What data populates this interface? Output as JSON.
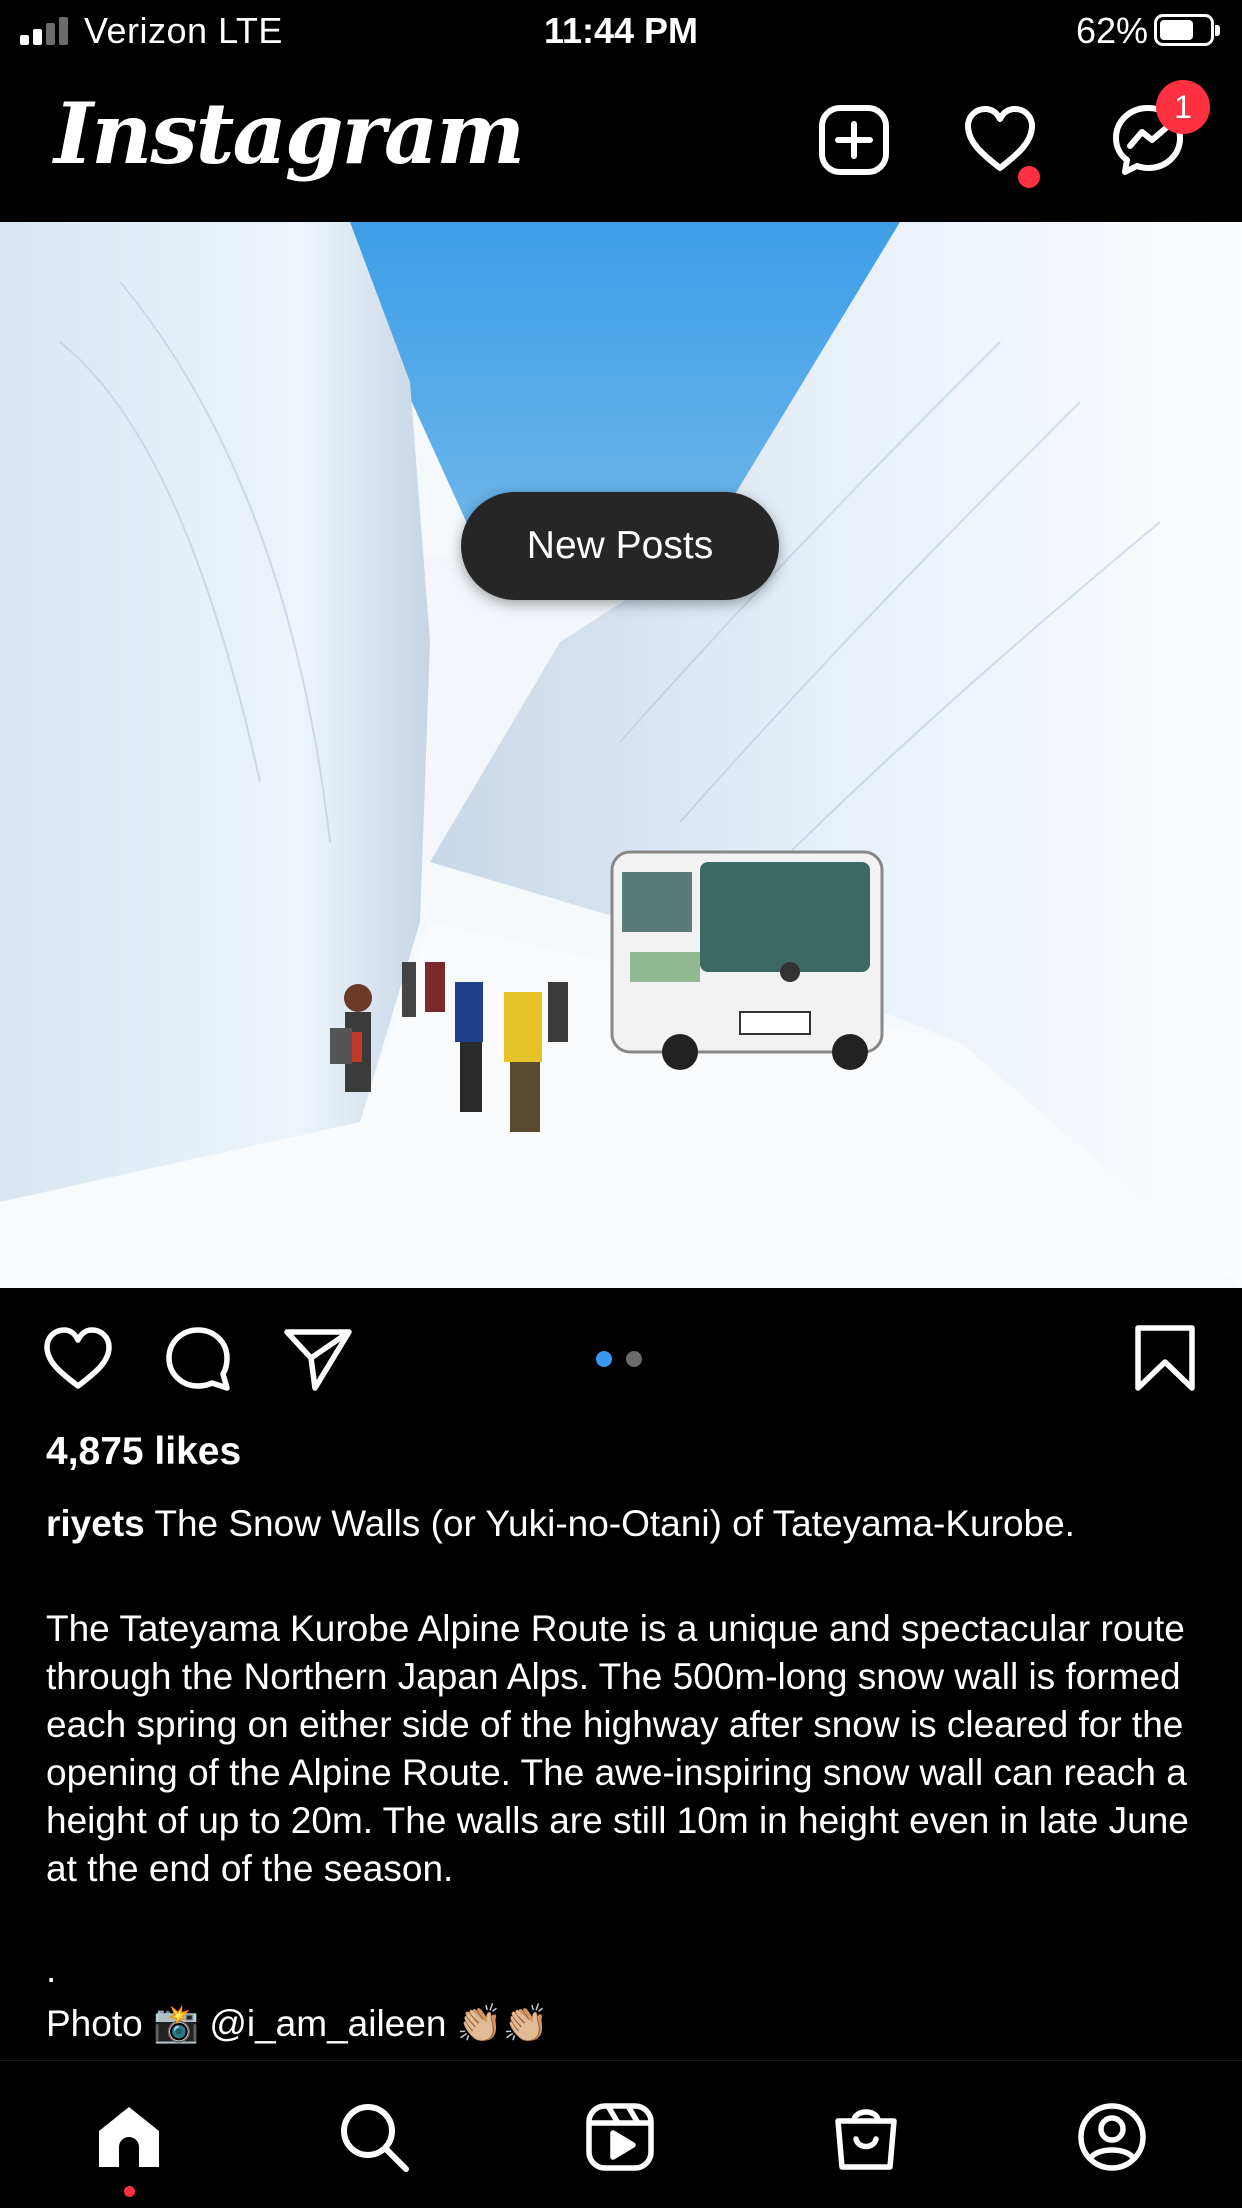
{
  "status_bar": {
    "carrier": "Verizon  LTE",
    "time": "11:44 PM",
    "battery_percent": "62%",
    "battery_level": 0.62,
    "signal_bars": 2
  },
  "header": {
    "logo": "Instagram",
    "icons": [
      "new-post-icon",
      "activity-heart-icon",
      "messenger-icon"
    ],
    "messages_badge": "1",
    "activity_dot_color": "#ff3040"
  },
  "feed": {
    "new_posts_label": "New Posts",
    "post": {
      "likes": "4,875 likes",
      "username": "riyets",
      "caption_title": " The Snow Walls (or Yuki-no-Otani) of Tateyama-Kurobe.",
      "caption_body": "The Tateyama Kurobe Alpine Route is a unique and spectacular route through the Northern Japan Alps. The 500m-long snow wall is formed each spring on either side of the highway after snow is cleared for the opening of the Alpine Route. The awe-inspiring snow wall can reach a height of up to 20m. The walls are still 10m in height even in late June at the end of the season.",
      "separator": ".",
      "photo_credit": "Photo 📸  @i_am_aileen 👏🏼👏🏼",
      "carousel_index": 1,
      "carousel_total": 2,
      "accent_color": "#3897f0"
    }
  },
  "bottom_nav": {
    "items": [
      "home-icon",
      "search-icon",
      "reels-icon",
      "shop-icon",
      "profile-icon"
    ],
    "active": "home-icon"
  }
}
